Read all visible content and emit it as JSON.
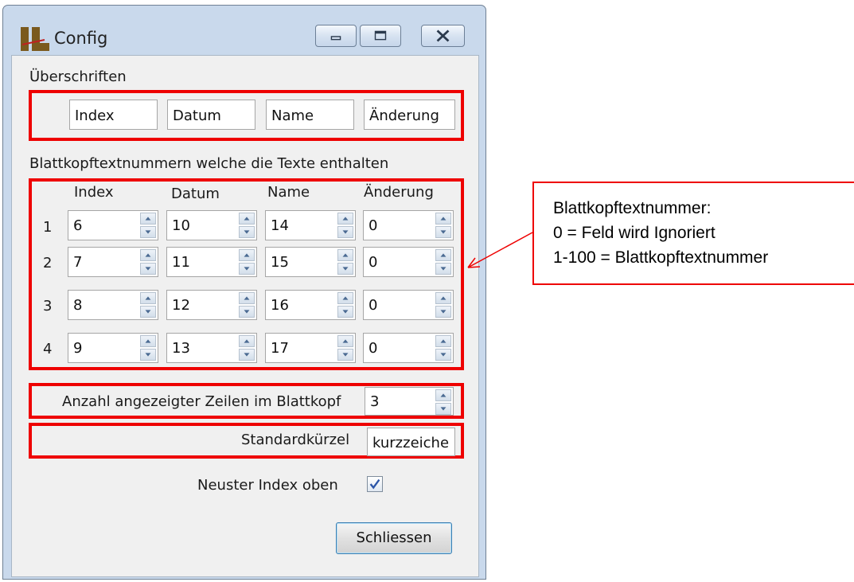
{
  "window": {
    "title": "Config",
    "controls": {
      "minimize": "minimize",
      "maximize": "maximize",
      "close": "close"
    }
  },
  "headings_section": {
    "label": "Überschriften",
    "fields": [
      "Index",
      "Datum",
      "Name",
      "Änderung"
    ]
  },
  "numbers_section": {
    "label": "Blattkopftextnummern welche die Texte enthalten",
    "columns": [
      "Index",
      "Datum",
      "Name",
      "Änderung"
    ],
    "rows": [
      {
        "num": "1",
        "values": [
          "6",
          "10",
          "14",
          "0"
        ]
      },
      {
        "num": "2",
        "values": [
          "7",
          "11",
          "15",
          "0"
        ]
      },
      {
        "num": "3",
        "values": [
          "8",
          "12",
          "16",
          "0"
        ]
      },
      {
        "num": "4",
        "values": [
          "9",
          "13",
          "17",
          "0"
        ]
      }
    ]
  },
  "row_count": {
    "label": "Anzahl angezeigter Zeilen im Blattkopf",
    "value": "3"
  },
  "abbreviation": {
    "label": "Standardkürzel",
    "value": "kurzzeiche"
  },
  "newest_index": {
    "label": "Neuster Index oben",
    "checked": true
  },
  "close_button": {
    "label": "Schliessen"
  },
  "callout": {
    "line1": "Blattkopftextnummer:",
    "line2": "0 = Feld wird Ignoriert",
    "line3": "1-100 = Blattkopftextnummer"
  },
  "colors": {
    "highlight": "#ee0000",
    "window_frame": "#c9d9ec"
  },
  "icons": {
    "app": "app-logo-icon",
    "spin_up": "arrow-up-icon",
    "spin_down": "arrow-down-icon",
    "check": "checkmark-icon"
  }
}
